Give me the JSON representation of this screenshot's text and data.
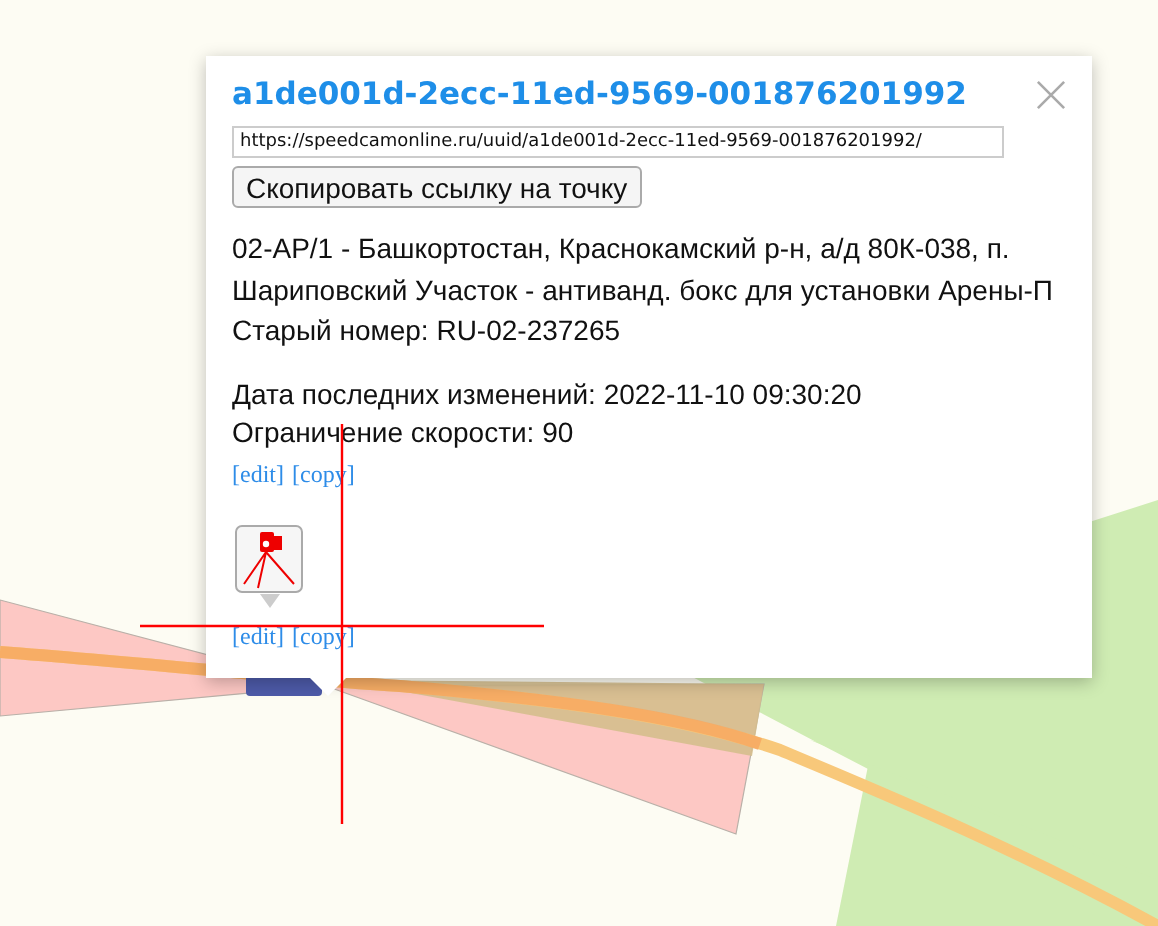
{
  "popup": {
    "title": "a1de001d-2ecc-11ed-9569-001876201992",
    "url": "https://speedcamonline.ru/uuid/a1de001d-2ecc-11ed-9569-001876201992/",
    "copy_button": "Скопировать ссылку на точку",
    "description_lines": [
      "02-АР/1 - Башкортостан, Краснокамский р-н, а/д 80К-038, п.",
      "Шариповский Участок - антиванд. бокс для установки Арены-П",
      "Старый номер: RU-02-237265"
    ],
    "details": [
      "Дата последних изменений: 2022-11-10 09:30:20",
      "Ограничение скорости: 90"
    ],
    "links_top": [
      "[edit]",
      "[copy]"
    ],
    "links_bottom": [
      "[edit]",
      "[copy]"
    ]
  }
}
